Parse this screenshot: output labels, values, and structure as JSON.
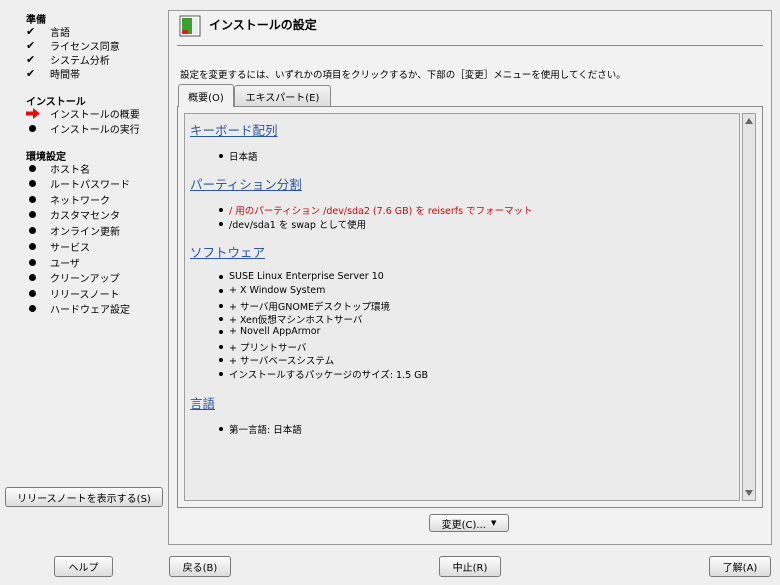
{
  "sidebar": {
    "sections": [
      {
        "title": "準備",
        "steps": [
          {
            "label": "言語",
            "state": "done"
          },
          {
            "label": "ライセンス同意",
            "state": "done"
          },
          {
            "label": "システム分析",
            "state": "done"
          },
          {
            "label": "時間帯",
            "state": "done"
          }
        ]
      },
      {
        "title": "インストール",
        "steps": [
          {
            "label": "インストールの概要",
            "state": "current"
          },
          {
            "label": "インストールの実行",
            "state": "pending"
          }
        ]
      },
      {
        "title": "環境設定",
        "steps": [
          {
            "label": "ホスト名",
            "state": "pending"
          },
          {
            "label": "ルートパスワード",
            "state": "pending"
          },
          {
            "label": "ネットワーク",
            "state": "pending"
          },
          {
            "label": "カスタマセンタ",
            "state": "pending"
          },
          {
            "label": "オンライン更新",
            "state": "pending"
          },
          {
            "label": "サービス",
            "state": "pending"
          },
          {
            "label": "ユーザ",
            "state": "pending"
          },
          {
            "label": "クリーンアップ",
            "state": "pending"
          },
          {
            "label": "リリースノート",
            "state": "pending"
          },
          {
            "label": "ハードウェア設定",
            "state": "pending"
          }
        ]
      }
    ],
    "release_notes_button": "リリースノートを表示する(S)"
  },
  "main": {
    "title": "インストールの設定",
    "instruction": "設定を変更するには、いずれかの項目をクリックするか、下部の［変更］メニューを使用してください。",
    "tabs": [
      {
        "label": "概要(O)",
        "active": true
      },
      {
        "label": "エキスパート(E)",
        "active": false
      }
    ],
    "sections": [
      {
        "heading": "キーボード配列",
        "items": [
          {
            "text": "日本語",
            "warning": false
          }
        ]
      },
      {
        "heading": "パーティション分割",
        "items": [
          {
            "text": "/ 用のパーティション /dev/sda2 (7.6 GB) を reiserfs でフォーマット",
            "warning": true
          },
          {
            "text": "/dev/sda1 を swap として使用",
            "warning": false
          }
        ]
      },
      {
        "heading": "ソフトウェア",
        "items": [
          {
            "text": "SUSE Linux Enterprise Server 10",
            "warning": false
          },
          {
            "text": "+ X Window System",
            "warning": false
          },
          {
            "text": "+ サーバ用GNOMEデスクトップ環境",
            "warning": false
          },
          {
            "text": "+ Xen仮想マシンホストサーバ",
            "warning": false
          },
          {
            "text": "+ Novell AppArmor",
            "warning": false
          },
          {
            "text": "+ プリントサーバ",
            "warning": false
          },
          {
            "text": "+ サーバベースシステム",
            "warning": false
          },
          {
            "text": "インストールするパッケージのサイズ: 1.5 GB",
            "warning": false
          }
        ]
      },
      {
        "heading": "言語",
        "items": [
          {
            "text": "第一言語: 日本語",
            "warning": false
          }
        ]
      }
    ],
    "change_button": "変更(C)..."
  },
  "bottom": {
    "help": "ヘルプ",
    "back": "戻る(B)",
    "abort": "中止(R)",
    "accept": "了解(A)"
  },
  "colors": {
    "warning": "#d40000",
    "link": "#2a56a8",
    "arrow": "#e01010"
  }
}
